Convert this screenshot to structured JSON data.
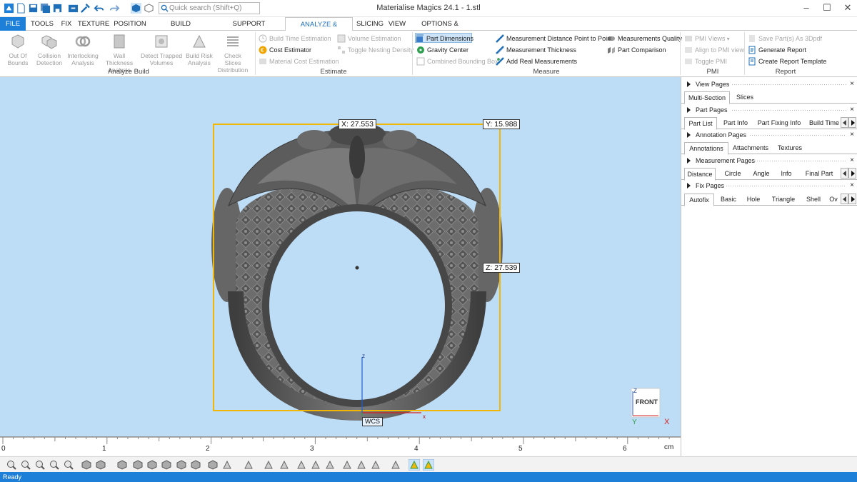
{
  "window": {
    "title": "Materialise Magics 24.1 - 1.stl",
    "minimize": "–",
    "maximize": "☐",
    "close": "✕"
  },
  "quick_search": {
    "placeholder": "Quick search (Shift+Q)"
  },
  "menu_tabs": [
    "FILE",
    "TOOLS",
    "FIX",
    "TEXTURE",
    "POSITION",
    "BUILD PREPARATION",
    "SUPPORT GENERATION",
    "ANALYZE & REPORT",
    "SLICING",
    "VIEW",
    "OPTIONS & HELP"
  ],
  "ribbon": {
    "analyze_build": {
      "label": "Analyze Build",
      "buttons": [
        {
          "l1": "Out Of",
          "l2": "Bounds"
        },
        {
          "l1": "Collision",
          "l2": "Detection"
        },
        {
          "l1": "Interlocking",
          "l2": "Analysis"
        },
        {
          "l1": "Wall Thickness",
          "l2": "Analysis"
        },
        {
          "l1": "Detect Trapped",
          "l2": "Volumes"
        },
        {
          "l1": "Build Risk",
          "l2": "Analysis"
        },
        {
          "l1": "Check Slices",
          "l2": "Distribution"
        }
      ]
    },
    "estimate": {
      "label": "Estimate",
      "items": [
        "Build Time Estimation",
        "Cost Estimator",
        "Material Cost Estimation",
        "Volume Estimation",
        "Toggle Nesting Density"
      ]
    },
    "measure": {
      "label": "Measure",
      "items": [
        "Part Dimensions",
        "Gravity Center",
        "Combined Bounding Box",
        "Measurement Distance Point to Point",
        "Measurement Thickness",
        "Add Real Measurements",
        "Measurements Quality",
        "Part Comparison"
      ]
    },
    "pmi": {
      "label": "PMI",
      "items": [
        "PMI Views",
        "Align to PMI view",
        "Toggle PMI"
      ]
    },
    "report": {
      "label": "Report",
      "items": [
        "Save Part(s) As 3Dpdf",
        "Generate Report",
        "Create Report Template"
      ]
    }
  },
  "viewport": {
    "dim_x": "X: 27.553",
    "dim_y": "Y: 15.988",
    "dim_z": "Z: 27.539",
    "wcs_label": "WCS",
    "axis_x": "x",
    "axis_z": "z",
    "view_cube": {
      "face": "FRONT",
      "z": "Z",
      "y": "Y",
      "x": "X"
    },
    "bbox_color": "#f2b705",
    "model_color": "#5a5a5a"
  },
  "ruler": {
    "ticks": [
      "0",
      "1",
      "2",
      "3",
      "4",
      "5",
      "6"
    ],
    "unit": "cm"
  },
  "panel": {
    "view_pages": {
      "title": "View Pages",
      "tabs": [
        "Multi-Section",
        "Slices"
      ]
    },
    "part_pages": {
      "title": "Part Pages",
      "tabs": [
        "Part List",
        "Part Info",
        "Part Fixing Info",
        "Build Time"
      ]
    },
    "annotation_pages": {
      "title": "Annotation Pages",
      "tabs": [
        "Annotations",
        "Attachments",
        "Textures"
      ]
    },
    "measurement_pages": {
      "title": "Measurement Pages",
      "tabs": [
        "Distance",
        "Circle",
        "Angle",
        "Info",
        "Final Part"
      ]
    },
    "fix_pages": {
      "title": "Fix Pages",
      "tabs": [
        "Autofix",
        "Basic",
        "Hole",
        "Triangle",
        "Shell",
        "Ov"
      ]
    },
    "close": "×"
  },
  "status": {
    "text": "Ready"
  },
  "colors": {
    "accent": "#1e7fd8",
    "viewport_bg": "#bddcf6"
  }
}
